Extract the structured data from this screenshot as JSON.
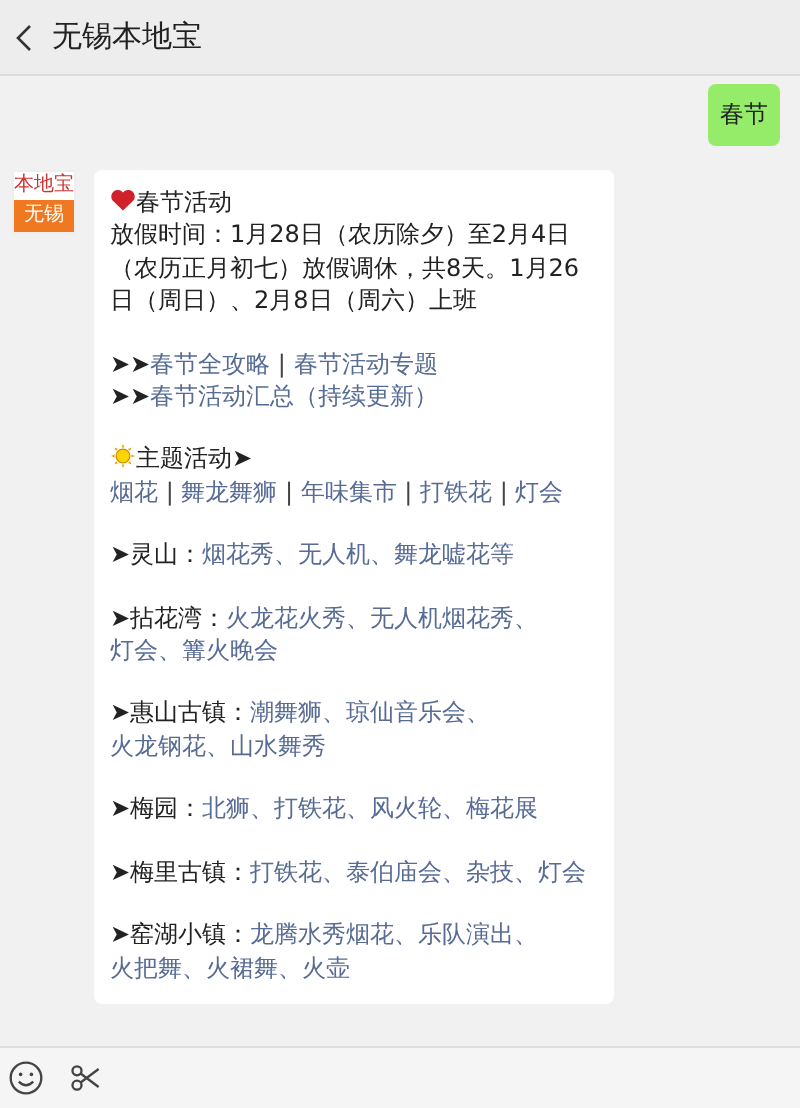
{
  "header": {
    "title": "无锡本地宝"
  },
  "outgoing": {
    "text": "春节"
  },
  "avatar": {
    "top": "本地宝",
    "bottom": "无锡"
  },
  "message": {
    "blocks": [
      {
        "lines": [
          [
            {
              "kind": "heart"
            },
            {
              "kind": "text",
              "text": "春节活动"
            }
          ],
          [
            {
              "kind": "text",
              "text": "放假时间：1月28日（农历除夕）至2月4日（农历正月初七）放假调休，共8天。1月26日（周日）、2月8日（周六）上班"
            }
          ]
        ]
      },
      {
        "lines": [
          [
            {
              "kind": "text",
              "text": "➤➤"
            },
            {
              "kind": "link",
              "text": "春节全攻略"
            },
            {
              "kind": "bar",
              "text": " | "
            },
            {
              "kind": "link",
              "text": "春节活动专题"
            }
          ],
          [
            {
              "kind": "text",
              "text": "➤➤"
            },
            {
              "kind": "link",
              "text": "春节活动汇总（持续更新）"
            }
          ]
        ]
      },
      {
        "lines": [
          [
            {
              "kind": "sun"
            },
            {
              "kind": "text",
              "text": "主题活动➤"
            },
            {
              "kind": "link",
              "text": "烟花"
            },
            {
              "kind": "bar",
              "text": " | "
            },
            {
              "kind": "link",
              "text": "舞龙舞狮"
            },
            {
              "kind": "bar",
              "text": " | "
            },
            {
              "kind": "link",
              "text": "年味集市"
            },
            {
              "kind": "bar",
              "text": " | "
            },
            {
              "kind": "link",
              "text": "打铁花"
            },
            {
              "kind": "bar",
              "text": " | "
            },
            {
              "kind": "link",
              "text": "灯会"
            }
          ]
        ]
      },
      {
        "lines": [
          [
            {
              "kind": "text",
              "text": "➤灵山："
            },
            {
              "kind": "link",
              "text": "烟花秀"
            },
            {
              "kind": "sep",
              "text": "、"
            },
            {
              "kind": "link",
              "text": "无人机"
            },
            {
              "kind": "sep",
              "text": "、"
            },
            {
              "kind": "link",
              "text": "舞龙嘘花等"
            }
          ]
        ]
      },
      {
        "lines": [
          [
            {
              "kind": "text",
              "text": "➤拈花湾："
            },
            {
              "kind": "link",
              "text": "火龙花火秀"
            },
            {
              "kind": "sep",
              "text": "、"
            },
            {
              "kind": "link",
              "text": "无人机烟花秀"
            },
            {
              "kind": "sep",
              "text": "、"
            },
            {
              "kind": "link",
              "text": "灯会"
            },
            {
              "kind": "sep",
              "text": "、"
            },
            {
              "kind": "link",
              "text": "篝火晚会"
            }
          ]
        ]
      },
      {
        "lines": [
          [
            {
              "kind": "text",
              "text": "➤惠山古镇："
            },
            {
              "kind": "link",
              "text": "潮舞狮"
            },
            {
              "kind": "sep",
              "text": "、"
            },
            {
              "kind": "link",
              "text": "琼仙音乐会"
            },
            {
              "kind": "sep",
              "text": "、"
            },
            {
              "kind": "link",
              "text": "火龙钢花"
            },
            {
              "kind": "sep",
              "text": "、"
            },
            {
              "kind": "link",
              "text": "山水舞秀"
            }
          ]
        ]
      },
      {
        "lines": [
          [
            {
              "kind": "text",
              "text": "➤梅园："
            },
            {
              "kind": "link",
              "text": "北狮"
            },
            {
              "kind": "sep",
              "text": "、"
            },
            {
              "kind": "link",
              "text": "打铁花"
            },
            {
              "kind": "sep",
              "text": "、"
            },
            {
              "kind": "link",
              "text": "风火轮"
            },
            {
              "kind": "sep",
              "text": "、"
            },
            {
              "kind": "link",
              "text": "梅花展"
            }
          ]
        ]
      },
      {
        "lines": [
          [
            {
              "kind": "text",
              "text": "➤梅里古镇："
            },
            {
              "kind": "link",
              "text": "打铁花"
            },
            {
              "kind": "sep",
              "text": "、"
            },
            {
              "kind": "link",
              "text": "泰伯庙会"
            },
            {
              "kind": "sep",
              "text": "、"
            },
            {
              "kind": "link",
              "text": "杂技"
            },
            {
              "kind": "sep",
              "text": "、"
            },
            {
              "kind": "link",
              "text": "灯会"
            }
          ]
        ]
      },
      {
        "lines": [
          [
            {
              "kind": "text",
              "text": "➤窑湖小镇："
            },
            {
              "kind": "link",
              "text": "龙腾水秀烟花"
            },
            {
              "kind": "sep",
              "text": "、"
            },
            {
              "kind": "link",
              "text": "乐队演出"
            },
            {
              "kind": "sep",
              "text": "、"
            },
            {
              "kind": "link",
              "text": "火把舞"
            },
            {
              "kind": "sep",
              "text": "、"
            },
            {
              "kind": "link",
              "text": "火裙舞"
            },
            {
              "kind": "sep",
              "text": "、"
            },
            {
              "kind": "link",
              "text": "火壶"
            }
          ]
        ]
      }
    ]
  }
}
